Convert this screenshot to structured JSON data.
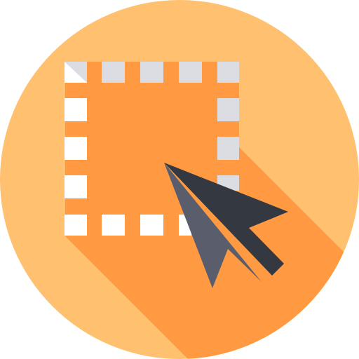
{
  "icon": {
    "name": "selection-tool-icon",
    "parts": [
      "circle-badge",
      "long-shadow",
      "dashed-selection-box",
      "cursor-arrow"
    ]
  },
  "colors": {
    "badge": "#FFC170",
    "shadow": "#FF9A42",
    "marquee_light": "#FFFFFF",
    "marquee_shade": "#DCDDE3",
    "cursor_light": "#5A5D6C",
    "cursor_dark": "#333841"
  }
}
